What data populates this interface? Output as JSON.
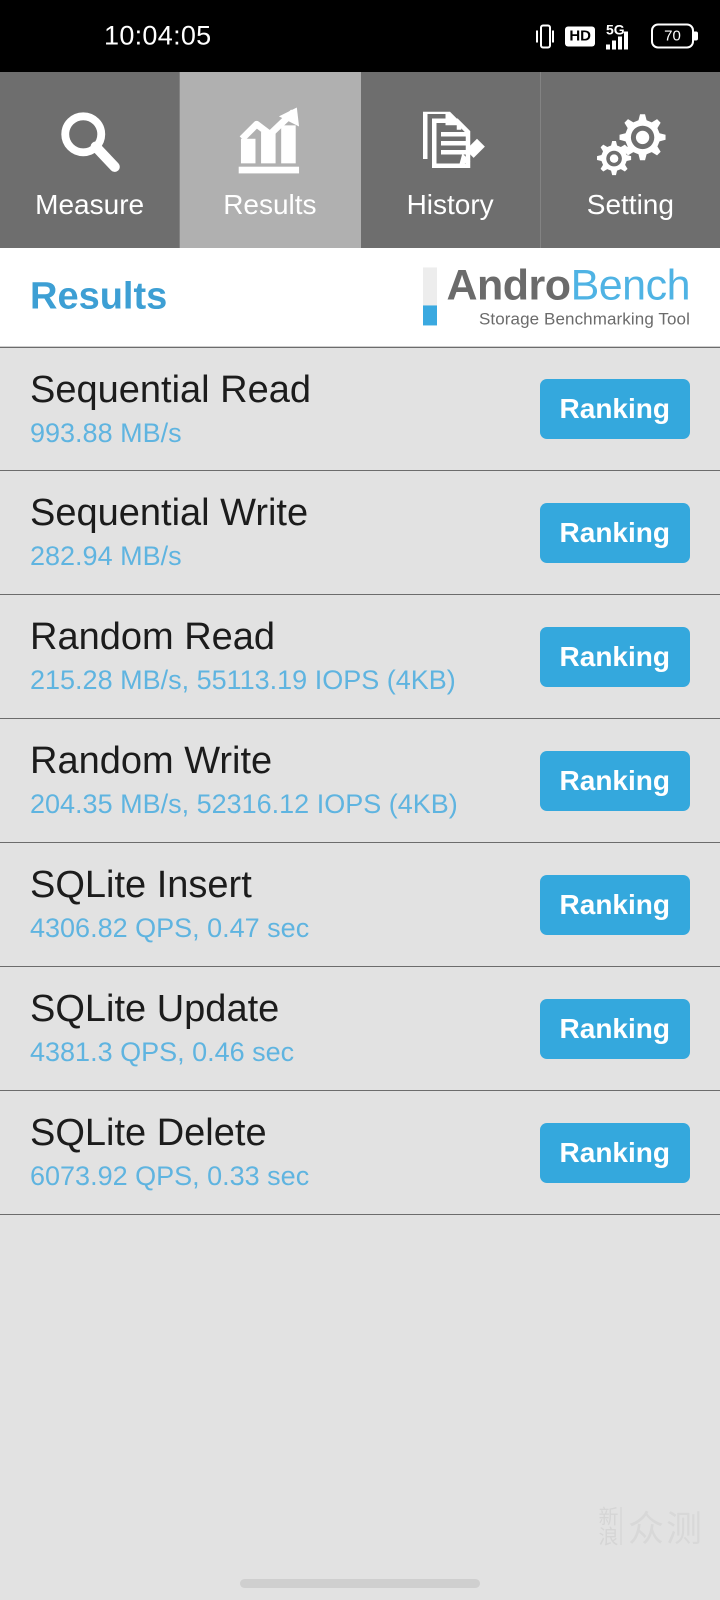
{
  "status_bar": {
    "time": "10:04:05",
    "hd_label": "HD",
    "network_label": "5G",
    "battery_level": "70",
    "icons": [
      "vibrate-icon",
      "hd-icon",
      "signal-5g-icon",
      "battery-icon"
    ]
  },
  "tabs": [
    {
      "label": "Measure",
      "icon": "magnifier-icon",
      "active": false
    },
    {
      "label": "Results",
      "icon": "bar-chart-icon",
      "active": true
    },
    {
      "label": "History",
      "icon": "document-pencil-icon",
      "active": false
    },
    {
      "label": "Setting",
      "icon": "gears-icon",
      "active": false
    }
  ],
  "header": {
    "title": "Results",
    "logo_primary": "Andro",
    "logo_secondary": "Bench",
    "logo_tagline": "Storage Benchmarking Tool"
  },
  "results": {
    "button_label": "Ranking",
    "rows": [
      {
        "title": "Sequential Read",
        "value": "993.88 MB/s"
      },
      {
        "title": "Sequential Write",
        "value": "282.94 MB/s"
      },
      {
        "title": "Random Read",
        "value": "215.28 MB/s, 55113.19 IOPS (4KB)"
      },
      {
        "title": "Random Write",
        "value": "204.35 MB/s, 52316.12 IOPS (4KB)"
      },
      {
        "title": "SQLite Insert",
        "value": "4306.82 QPS, 0.47 sec"
      },
      {
        "title": "SQLite Update",
        "value": "4381.3 QPS, 0.46 sec"
      },
      {
        "title": "SQLite Delete",
        "value": "6073.92 QPS, 0.33 sec"
      }
    ]
  },
  "watermark": {
    "brand": "新浪",
    "name": "众测"
  },
  "colors": {
    "accent_blue": "#34a8dd",
    "title_blue": "#3d9fd4",
    "value_blue": "#5fb4e0",
    "tab_bg": "#6e6e6e",
    "tab_active_bg": "#b0b0b0",
    "page_bg": "#e2e2e2",
    "status_bg": "#000000"
  }
}
